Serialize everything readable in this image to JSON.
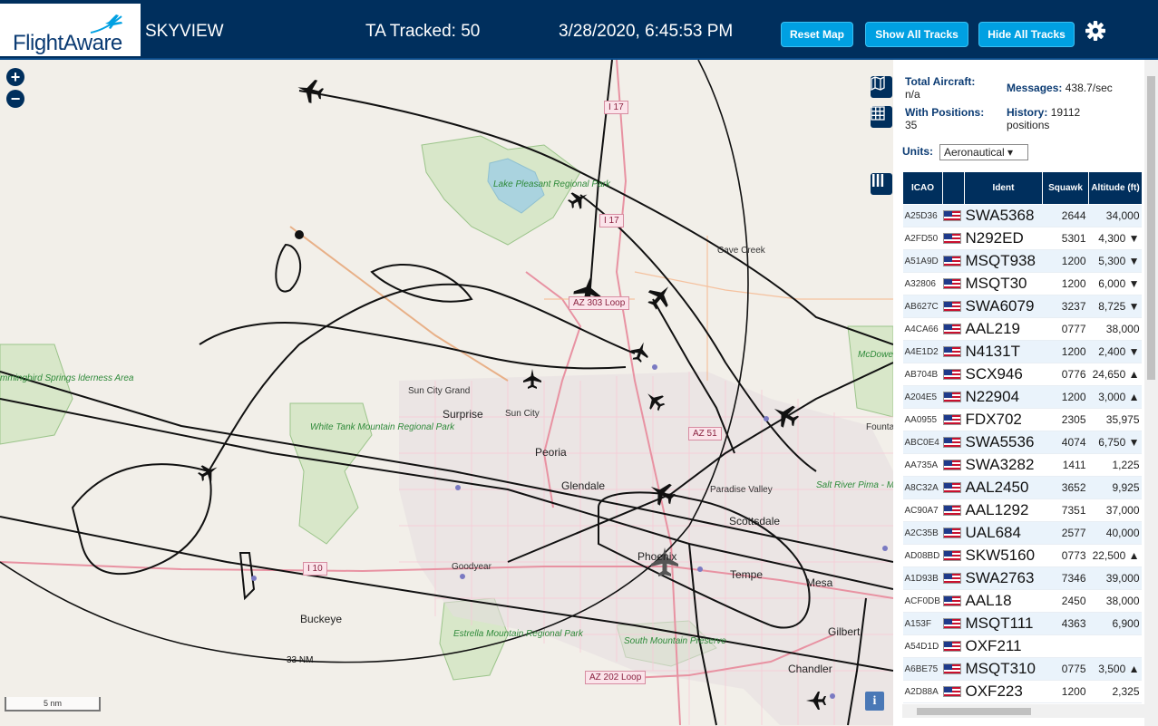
{
  "header": {
    "logo_text": "FlightAware",
    "app_title": "SKYVIEW",
    "tracked": "TA Tracked: 50",
    "clock": "3/28/2020, 6:45:53 PM",
    "buttons": {
      "reset": "Reset Map",
      "show_all": "Show All Tracks",
      "hide_all": "Hide All Tracks"
    },
    "settings_icon": "gear-icon"
  },
  "map": {
    "zoom_in": "+",
    "zoom_out": "−",
    "range_ring_label": "33 NM",
    "scale_label": "5 nm",
    "info_label": "i",
    "labels": {
      "lake_pleasant": "Lake Pleasant Regional Park",
      "cave_creek": "Cave Creek",
      "sun_city_grand": "Sun City Grand",
      "surprise": "Surprise",
      "sun_city": "Sun City",
      "white_tank": "White Tank Mountain Regional Park",
      "peoria": "Peoria",
      "glendale": "Glendale",
      "paradise_valley": "Paradise Valley",
      "salt_river": "Salt River Pima - Maricopa Indian Community",
      "scottsdale": "Scottsdale",
      "phoenix": "Phoenix",
      "goodyear": "Goodyear",
      "tempe": "Tempe",
      "mesa": "Mesa",
      "buckeye": "Buckeye",
      "estrella": "Estrella Mountain Regional Park",
      "south_mountain": "South Mountain Preserve",
      "gilbert": "Gilbert",
      "chandler": "Chandler",
      "hummingbird": "mmingbird Springs lderness Area",
      "mcdowell": "McDowe Regiona Park",
      "fountain": "Founta"
    },
    "shields": {
      "i17_north": "I 17",
      "i17_mid": "I 17",
      "az303": "AZ 303 Loop",
      "az51": "AZ 51",
      "i10": "I 10",
      "az202": "AZ 202 Loop"
    }
  },
  "panel": {
    "total_aircraft_label": "Total Aircraft:",
    "total_aircraft_value": "n/a",
    "messages_label": "Messages:",
    "messages_value": "438.7/sec",
    "with_positions_label": "With Positions:",
    "with_positions_value": "35",
    "history_label": "History:",
    "history_value": "19112 positions",
    "units_label": "Units:",
    "units_value": "Aeronautical ▾",
    "columns": {
      "icao": "ICAO",
      "ident": "Ident",
      "squawk": "Squawk",
      "altitude": "Altitude (ft)"
    },
    "rows": [
      {
        "icao": "A25D36",
        "ident": "SWA5368",
        "squawk": "2644",
        "alt": "34,000"
      },
      {
        "icao": "A2FD50",
        "ident": "N292ED",
        "squawk": "5301",
        "alt": "4,300 ▼"
      },
      {
        "icao": "A51A9D",
        "ident": "MSQT938",
        "squawk": "1200",
        "alt": "5,300 ▼"
      },
      {
        "icao": "A32806",
        "ident": "MSQT30",
        "squawk": "1200",
        "alt": "6,000 ▼"
      },
      {
        "icao": "AB627C",
        "ident": "SWA6079",
        "squawk": "3237",
        "alt": "8,725 ▼"
      },
      {
        "icao": "A4CA66",
        "ident": "AAL219",
        "squawk": "0777",
        "alt": "38,000"
      },
      {
        "icao": "A4E1D2",
        "ident": "N4131T",
        "squawk": "1200",
        "alt": "2,400 ▼"
      },
      {
        "icao": "AB704B",
        "ident": "SCX946",
        "squawk": "0776",
        "alt": "24,650 ▲"
      },
      {
        "icao": "A204E5",
        "ident": "N22904",
        "squawk": "1200",
        "alt": "3,000 ▲"
      },
      {
        "icao": "AA0955",
        "ident": "FDX702",
        "squawk": "2305",
        "alt": "35,975"
      },
      {
        "icao": "ABC0E4",
        "ident": "SWA5536",
        "squawk": "4074",
        "alt": "6,750 ▼"
      },
      {
        "icao": "AA735A",
        "ident": "SWA3282",
        "squawk": "1411",
        "alt": "1,225"
      },
      {
        "icao": "A8C32A",
        "ident": "AAL2450",
        "squawk": "3652",
        "alt": "9,925"
      },
      {
        "icao": "AC90A7",
        "ident": "AAL1292",
        "squawk": "7351",
        "alt": "37,000"
      },
      {
        "icao": "A2C35B",
        "ident": "UAL684",
        "squawk": "2577",
        "alt": "40,000"
      },
      {
        "icao": "AD08BD",
        "ident": "SKW5160",
        "squawk": "0773",
        "alt": "22,500 ▲"
      },
      {
        "icao": "A1D93B",
        "ident": "SWA2763",
        "squawk": "7346",
        "alt": "39,000"
      },
      {
        "icao": "ACF0DB",
        "ident": "AAL18",
        "squawk": "2450",
        "alt": "38,000"
      },
      {
        "icao": "A153F",
        "ident": "MSQT111",
        "squawk": "4363",
        "alt": "6,900"
      },
      {
        "icao": "A54D1D",
        "ident": "OXF211",
        "squawk": "",
        "alt": ""
      },
      {
        "icao": "A6BE75",
        "ident": "MSQT310",
        "squawk": "0775",
        "alt": "3,500 ▲"
      },
      {
        "icao": "A2D88A",
        "ident": "OXF223",
        "squawk": "1200",
        "alt": "2,325"
      }
    ]
  }
}
